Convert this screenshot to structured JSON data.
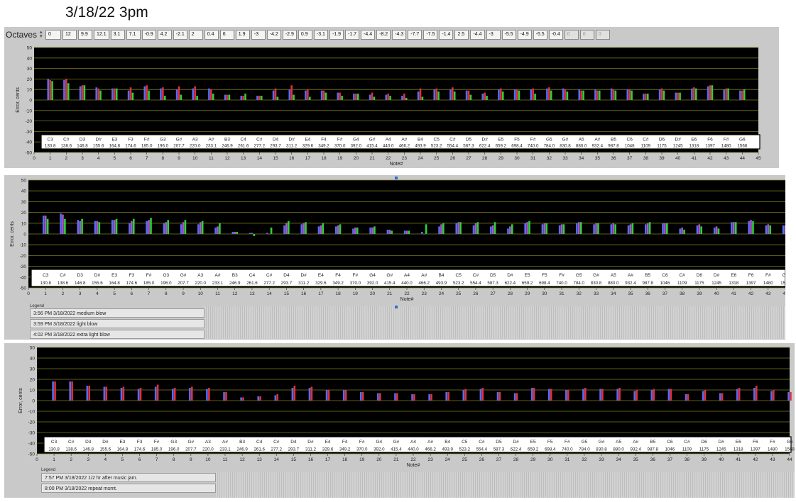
{
  "title": "3/18/22 3pm",
  "octaves": {
    "label": "Octaves",
    "index": "0",
    "values": [
      "12",
      "9.9",
      "12.1",
      "3.1",
      "7.1",
      "-0.9",
      "4.2",
      "-2.1",
      "2",
      "0.4",
      "6",
      "1.9",
      "-3",
      "-4.2",
      "-2.9",
      "0.9",
      "-3.1",
      "-1.9",
      "-1.7",
      "-4.4",
      "-8.2",
      "-4.3",
      "-7.7",
      "-7.5",
      "-1.4",
      "2.5",
      "-4.4",
      "-3",
      "-5.5",
      "-4.9",
      "-5.5",
      "-0.4",
      "0",
      "0",
      "0"
    ]
  },
  "notes": [
    "C3",
    "C#",
    "D3",
    "D#",
    "E3",
    "F3",
    "F#",
    "G3",
    "G#",
    "A3",
    "A#",
    "B3",
    "C4",
    "C#",
    "D4",
    "D#",
    "E4",
    "F4",
    "F#",
    "G4",
    "G#",
    "A4",
    "A#",
    "B4",
    "C5",
    "C#",
    "D5",
    "D#",
    "E5",
    "F5",
    "F#",
    "G5",
    "G#",
    "A5",
    "A#",
    "B5",
    "C6",
    "C#",
    "D6",
    "D#",
    "E6",
    "F6",
    "F#",
    "G6"
  ],
  "freqs": [
    "130.8",
    "138.6",
    "146.8",
    "155.6",
    "164.8",
    "174.6",
    "185.0",
    "196.0",
    "207.7",
    "220.0",
    "233.1",
    "246.9",
    "261.6",
    "277.2",
    "293.7",
    "311.2",
    "329.6",
    "349.2",
    "370.0",
    "392.0",
    "415.4",
    "440.0",
    "466.2",
    "493.9",
    "523.2",
    "554.4",
    "587.3",
    "622.4",
    "659.2",
    "698.4",
    "740.0",
    "784.0",
    "830.8",
    "880.0",
    "932.4",
    "987.8",
    "1046",
    "1109",
    "1175",
    "1245",
    "1318",
    "1397",
    "1480",
    "1568"
  ],
  "charts": {
    "ylabel": "Error, cents",
    "xlabel": "Note#",
    "legend_title": "Legend"
  },
  "colors": {
    "plot_bg": "#000000",
    "grid": "#7a7a1e",
    "blue": "#5b6cf0",
    "red": "#e0303c",
    "green": "#2fd13a",
    "purple": "#a858c8"
  },
  "chart_data": [
    {
      "type": "bar",
      "ylabel": "Error, cents",
      "xlabel": "Note#",
      "ylim": [
        -50,
        50
      ],
      "xlim": [
        0,
        45
      ],
      "x": [
        1,
        2,
        3,
        4,
        5,
        6,
        7,
        8,
        9,
        10,
        11,
        12,
        13,
        14,
        15,
        16,
        17,
        18,
        19,
        20,
        21,
        22,
        23,
        24,
        25,
        26,
        27,
        28,
        29,
        30,
        31,
        32,
        33,
        34,
        35,
        36,
        37,
        38,
        39,
        40,
        41,
        42,
        43,
        44
      ],
      "series": [
        {
          "color": "blue",
          "values": [
            20,
            19,
            13,
            12,
            11,
            9,
            13,
            11,
            10,
            11,
            11,
            5,
            4,
            4,
            9,
            10,
            9,
            9,
            7,
            6,
            5,
            5,
            4,
            8,
            10,
            10,
            9,
            6,
            10,
            10,
            10,
            11,
            11,
            10,
            10,
            11,
            10,
            6,
            10,
            7,
            11,
            13,
            10,
            9
          ]
        },
        {
          "color": "red",
          "values": [
            19,
            20,
            14,
            11,
            11,
            12,
            14,
            12,
            13,
            13,
            10,
            5,
            4,
            4,
            11,
            14,
            10,
            9,
            7,
            6,
            7,
            6,
            6,
            11,
            11,
            12,
            9,
            7,
            11,
            10,
            11,
            12,
            10,
            9,
            9,
            10,
            10,
            6,
            11,
            7,
            12,
            14,
            11,
            9
          ]
        },
        {
          "color": "green",
          "values": [
            18,
            16,
            14,
            9,
            11,
            7,
            9,
            4,
            5,
            4,
            6,
            5,
            6,
            4,
            3,
            5,
            3,
            7,
            4,
            6,
            3,
            4,
            2,
            3,
            8,
            8,
            5,
            4,
            8,
            9,
            6,
            9,
            8,
            9,
            9,
            9,
            9,
            6,
            9,
            7,
            11,
            14,
            11,
            10
          ]
        }
      ]
    },
    {
      "type": "bar",
      "ylabel": "Error, cents",
      "xlabel": "Note#",
      "ylim": [
        -50,
        50
      ],
      "xlim": [
        0,
        44
      ],
      "x": [
        1,
        2,
        3,
        4,
        5,
        6,
        7,
        8,
        9,
        10,
        11,
        12,
        13,
        14,
        15,
        16,
        17,
        18,
        19,
        20,
        21,
        22,
        23,
        24,
        25,
        26,
        27,
        28,
        29,
        30,
        31,
        32,
        33,
        34,
        35,
        36,
        37,
        38,
        39,
        40,
        41,
        42,
        43,
        44
      ],
      "series": [
        {
          "name": "3:56 PM 3/18/2022 medium blow",
          "color": "blue",
          "values": [
            17,
            19,
            13,
            12,
            13,
            10,
            12,
            10,
            9,
            9,
            6,
            2,
            1,
            1,
            8,
            9,
            7,
            7,
            5,
            6,
            4,
            3,
            2,
            7,
            10,
            8,
            7,
            5,
            10,
            9,
            8,
            10,
            9,
            9,
            8,
            9,
            10,
            5,
            8,
            6,
            11,
            12,
            8,
            8
          ]
        },
        {
          "name": "3:59 PM 3/18/2022 light blow",
          "color": "purple",
          "values": [
            17,
            18,
            12,
            12,
            13,
            12,
            13,
            11,
            11,
            11,
            7,
            2,
            1,
            0,
            10,
            10,
            8,
            8,
            6,
            6,
            4,
            3,
            0,
            9,
            11,
            10,
            8,
            7,
            11,
            10,
            9,
            11,
            10,
            10,
            9,
            10,
            10,
            6,
            9,
            7,
            11,
            13,
            9,
            8
          ]
        },
        {
          "name": "4:02 PM 3/18/2022 extra light blow",
          "color": "green",
          "values": [
            14,
            14,
            14,
            11,
            14,
            14,
            15,
            13,
            13,
            12,
            10,
            2,
            -2,
            6,
            12,
            11,
            10,
            9,
            6,
            7,
            3,
            3,
            9,
            10,
            11,
            11,
            11,
            9,
            12,
            10,
            9,
            11,
            10,
            9,
            10,
            11,
            10,
            4,
            7,
            5,
            11,
            12,
            8,
            8
          ]
        }
      ]
    },
    {
      "type": "bar",
      "ylabel": "Error, cents",
      "xlabel": "Note#",
      "ylim": [
        -50,
        50
      ],
      "xlim": [
        0,
        44
      ],
      "x": [
        1,
        2,
        3,
        4,
        5,
        6,
        7,
        8,
        9,
        10,
        11,
        12,
        13,
        14,
        15,
        16,
        17,
        18,
        19,
        20,
        21,
        22,
        23,
        24,
        25,
        26,
        27,
        28,
        29,
        30,
        31,
        32,
        33,
        34,
        35,
        36,
        37,
        38,
        39,
        40,
        41,
        42,
        43,
        44
      ],
      "series": [
        {
          "name": "7:57 PM 3/18/2022 1/2 hr after music jam.",
          "color": "blue",
          "values": [
            18,
            18,
            14,
            13,
            12,
            11,
            13,
            11,
            12,
            11,
            8,
            3,
            4,
            5,
            12,
            12,
            10,
            10,
            8,
            7,
            7,
            6,
            6,
            8,
            10,
            11,
            8,
            7,
            12,
            11,
            10,
            11,
            11,
            11,
            9,
            10,
            11,
            6,
            9,
            7,
            11,
            12,
            9,
            8
          ]
        },
        {
          "name": "8:00 PM 3/18/2022 repeat msmt.",
          "color": "red",
          "values": [
            18,
            18,
            14,
            13,
            13,
            12,
            15,
            12,
            13,
            12,
            8,
            3,
            4,
            6,
            14,
            13,
            10,
            10,
            8,
            7,
            7,
            6,
            6,
            8,
            11,
            12,
            8,
            7,
            12,
            11,
            10,
            12,
            11,
            12,
            10,
            11,
            11,
            6,
            10,
            7,
            12,
            14,
            10,
            8
          ]
        }
      ]
    }
  ]
}
